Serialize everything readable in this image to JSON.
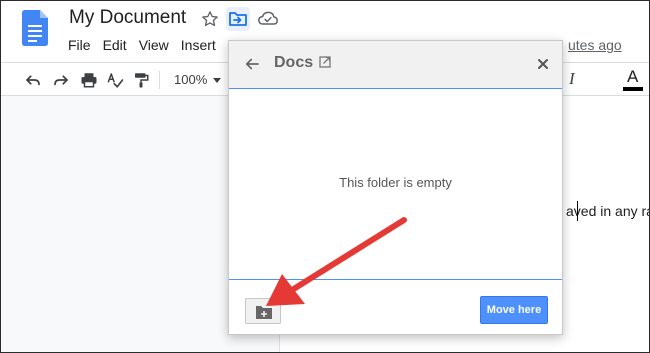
{
  "document": {
    "title": "My Document",
    "last_edit": "utes ago",
    "body_text": "aved in any ra"
  },
  "menu": [
    "File",
    "Edit",
    "View",
    "Insert"
  ],
  "toolbar": {
    "zoom": "100%",
    "italic": "I",
    "text_color_letter": "A"
  },
  "dialog": {
    "folder_name": "Docs",
    "empty_message": "This folder is empty",
    "move_here_label": "Move here"
  },
  "colors": {
    "docs_blue": "#4285f4",
    "accent_blue": "#4d90fe",
    "annotation_red": "#e53935"
  }
}
